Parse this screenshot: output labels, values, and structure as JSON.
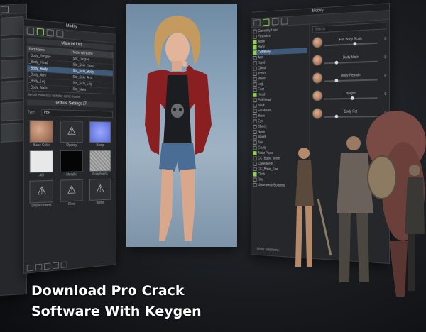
{
  "caption": {
    "line1": "Download Pro Crack",
    "line2": "Software With Keygen"
  },
  "material_panel": {
    "title": "Modify",
    "section_title": "Material List",
    "columns": [
      "Part Name",
      "Material Name"
    ],
    "rows": [
      [
        "_Body_Tongue",
        "Std_Tongue"
      ],
      [
        "_Body_Head",
        "Std_Skin_Head"
      ],
      [
        "_Body_Body",
        "Std_Skin_Body"
      ],
      [
        "_Body_Arm",
        "Std_Skin_Arm"
      ],
      [
        "_Body_Leg",
        "Std_Skin_Leg"
      ],
      [
        "_Body_Nails",
        "Std_Nails"
      ]
    ],
    "selected_row": 2,
    "note": "Set all materials with the same name",
    "section2_title": "Texture Settings (7)",
    "type_label": "Type",
    "type_value": "PBR",
    "textures": [
      {
        "label": "Base Color",
        "swatch": "skin"
      },
      {
        "label": "Opacity",
        "swatch": "warn"
      },
      {
        "label": "Bump",
        "swatch": "blue"
      },
      {
        "label": "AO",
        "swatch": "white"
      },
      {
        "label": "Metallic",
        "swatch": "black"
      },
      {
        "label": "Roughness",
        "swatch": "grey"
      },
      {
        "label": "Displacement",
        "swatch": "warn"
      },
      {
        "label": "Glow",
        "swatch": "warn"
      },
      {
        "label": "Blend",
        "swatch": "warn"
      }
    ]
  },
  "body_panel": {
    "title": "Modify",
    "search_placeholder": "Search",
    "tree": [
      {
        "label": "Currently Used",
        "checked": false,
        "selected": false
      },
      {
        "label": "Favorites",
        "checked": false,
        "selected": false
      },
      {
        "label": "Actor",
        "checked": true,
        "selected": false
      },
      {
        "label": "Body",
        "checked": true,
        "selected": false
      },
      {
        "label": "Full Body",
        "checked": true,
        "selected": true
      },
      {
        "label": "Arm",
        "checked": false,
        "selected": false
      },
      {
        "label": "Hand",
        "checked": false,
        "selected": false
      },
      {
        "label": "Chest",
        "checked": false,
        "selected": false
      },
      {
        "label": "Torso",
        "checked": false,
        "selected": false
      },
      {
        "label": "Waist",
        "checked": false,
        "selected": false
      },
      {
        "label": "Leg",
        "checked": false,
        "selected": false
      },
      {
        "label": "Foot",
        "checked": false,
        "selected": false
      },
      {
        "label": "Head",
        "checked": true,
        "selected": false
      },
      {
        "label": "Full Head",
        "checked": false,
        "selected": false
      },
      {
        "label": "Skull",
        "checked": false,
        "selected": false
      },
      {
        "label": "Forehead",
        "checked": false,
        "selected": false
      },
      {
        "label": "Brow",
        "checked": false,
        "selected": false
      },
      {
        "label": "Eye",
        "checked": false,
        "selected": false
      },
      {
        "label": "Cheek",
        "checked": false,
        "selected": false
      },
      {
        "label": "Nose",
        "checked": false,
        "selected": false
      },
      {
        "label": "Mouth",
        "checked": false,
        "selected": false
      },
      {
        "label": "Jaw",
        "checked": false,
        "selected": false
      },
      {
        "label": "Cavity",
        "checked": false,
        "selected": false
      },
      {
        "label": "Actor Parts",
        "checked": true,
        "selected": false
      },
      {
        "label": "CC_Base_Teeth",
        "checked": false,
        "selected": false
      },
      {
        "label": "Lowerteeth",
        "checked": false,
        "selected": false
      },
      {
        "label": "CC_Base_Eye",
        "checked": false,
        "selected": false
      },
      {
        "label": "Cloth",
        "checked": true,
        "selected": false
      },
      {
        "label": "Bra",
        "checked": false,
        "selected": false
      },
      {
        "label": "Underwear Bottoms",
        "checked": false,
        "selected": false
      }
    ],
    "footer_option": "Show Sub Items",
    "sliders": [
      {
        "label": "Full Body Scale",
        "value": "0",
        "fraction": 0.55
      },
      {
        "label": "Body Male",
        "value": "0",
        "fraction": 0.2
      },
      {
        "label": "Body Female",
        "value": "0",
        "fraction": 0.2
      },
      {
        "label": "Height",
        "value": "0",
        "fraction": 0.5
      },
      {
        "label": "Body Fat",
        "value": "0",
        "fraction": 0.2
      }
    ]
  },
  "colors": {
    "accent": "#8fd14f",
    "selection": "#3f5a78",
    "panel_bg": "#25272a",
    "viewport_bg": "#8ca5bb"
  }
}
